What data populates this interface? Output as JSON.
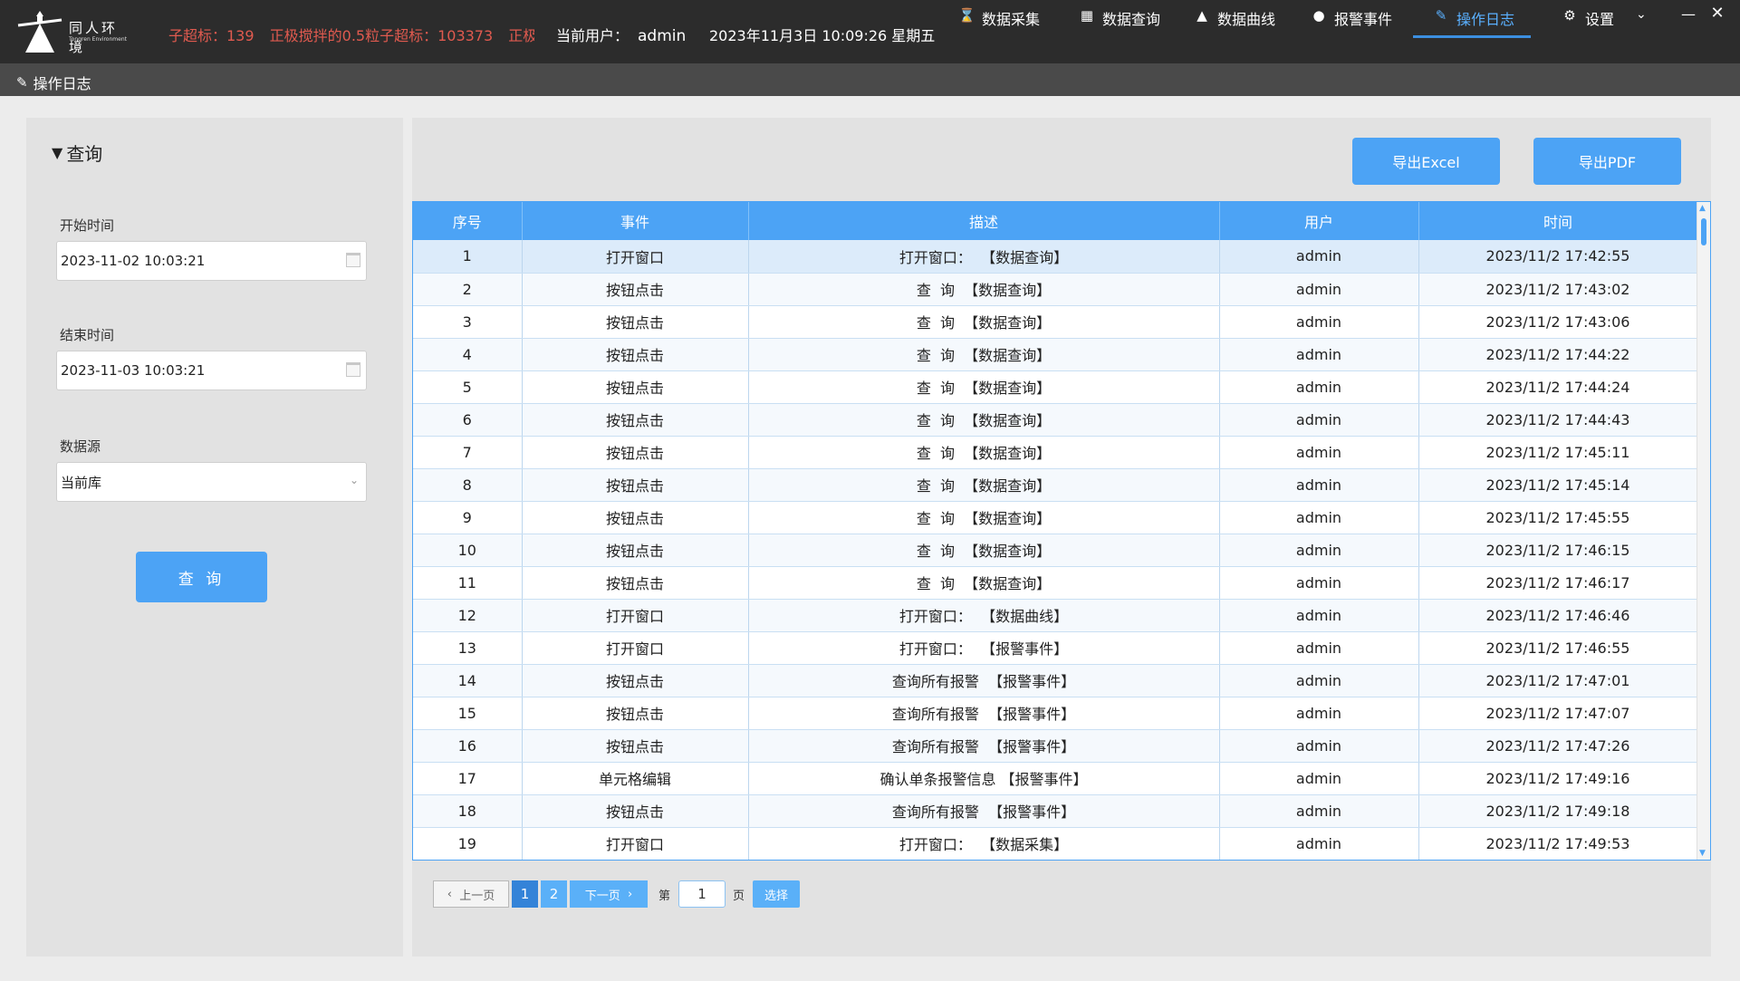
{
  "brand": {
    "name_cn": "同人环境",
    "name_en": "Tongren Environment"
  },
  "ticker": [
    "子超标：139",
    "正极搅拌的0.5粒子超标：103373",
    "正极搅"
  ],
  "header": {
    "user_label": "当前用户：",
    "user_name": "admin",
    "datetime": "2023年11月3日 10:09:26 星期五"
  },
  "nav": [
    {
      "label": "数据采集",
      "icon": "hourglass-icon"
    },
    {
      "label": "数据查询",
      "icon": "table-icon"
    },
    {
      "label": "数据曲线",
      "icon": "area-chart-icon"
    },
    {
      "label": "报警事件",
      "icon": "alert-icon"
    },
    {
      "label": "操作日志",
      "icon": "edit-icon"
    },
    {
      "label": "设置",
      "icon": "gear-icon"
    }
  ],
  "active_nav": "操作日志",
  "page_title": "操作日志",
  "query": {
    "title": "查询",
    "start_label": "开始时间",
    "start_value": "2023-11-02 10:03:21",
    "end_label": "结束时间",
    "end_value": "2023-11-03 10:03:21",
    "source_label": "数据源",
    "source_value": "当前库",
    "button": "查 询"
  },
  "export": {
    "excel": "导出Excel",
    "pdf": "导出PDF"
  },
  "table": {
    "columns": [
      "序号",
      "事件",
      "描述",
      "用户",
      "时间"
    ],
    "rows": [
      [
        "1",
        "打开窗口",
        "打开窗口：  【数据查询】",
        "admin",
        "2023/11/2 17:42:55"
      ],
      [
        "2",
        "按钮点击",
        "查  询  【数据查询】",
        "admin",
        "2023/11/2 17:43:02"
      ],
      [
        "3",
        "按钮点击",
        "查  询  【数据查询】",
        "admin",
        "2023/11/2 17:43:06"
      ],
      [
        "4",
        "按钮点击",
        "查  询  【数据查询】",
        "admin",
        "2023/11/2 17:44:22"
      ],
      [
        "5",
        "按钮点击",
        "查  询  【数据查询】",
        "admin",
        "2023/11/2 17:44:24"
      ],
      [
        "6",
        "按钮点击",
        "查  询  【数据查询】",
        "admin",
        "2023/11/2 17:44:43"
      ],
      [
        "7",
        "按钮点击",
        "查  询  【数据查询】",
        "admin",
        "2023/11/2 17:45:11"
      ],
      [
        "8",
        "按钮点击",
        "查  询  【数据查询】",
        "admin",
        "2023/11/2 17:45:14"
      ],
      [
        "9",
        "按钮点击",
        "查  询  【数据查询】",
        "admin",
        "2023/11/2 17:45:55"
      ],
      [
        "10",
        "按钮点击",
        "查  询  【数据查询】",
        "admin",
        "2023/11/2 17:46:15"
      ],
      [
        "11",
        "按钮点击",
        "查  询  【数据查询】",
        "admin",
        "2023/11/2 17:46:17"
      ],
      [
        "12",
        "打开窗口",
        "打开窗口：  【数据曲线】",
        "admin",
        "2023/11/2 17:46:46"
      ],
      [
        "13",
        "打开窗口",
        "打开窗口：  【报警事件】",
        "admin",
        "2023/11/2 17:46:55"
      ],
      [
        "14",
        "按钮点击",
        "查询所有报警  【报警事件】",
        "admin",
        "2023/11/2 17:47:01"
      ],
      [
        "15",
        "按钮点击",
        "查询所有报警  【报警事件】",
        "admin",
        "2023/11/2 17:47:07"
      ],
      [
        "16",
        "按钮点击",
        "查询所有报警  【报警事件】",
        "admin",
        "2023/11/2 17:47:26"
      ],
      [
        "17",
        "单元格编辑",
        "确认单条报警信息 【报警事件】",
        "admin",
        "2023/11/2 17:49:16"
      ],
      [
        "18",
        "按钮点击",
        "查询所有报警  【报警事件】",
        "admin",
        "2023/11/2 17:49:18"
      ],
      [
        "19",
        "打开窗口",
        "打开窗口：  【数据采集】",
        "admin",
        "2023/11/2 17:49:53"
      ]
    ]
  },
  "pager": {
    "prev": "上一页",
    "pages": [
      "1",
      "2"
    ],
    "current": "1",
    "next": "下一页",
    "go_prefix": "第",
    "go_value": "1",
    "go_suffix": "页",
    "go_button": "选择"
  },
  "colors": {
    "accent": "#4ca3f5",
    "titlebar": "#2c2c2c",
    "alert_text": "#e05a4f"
  }
}
